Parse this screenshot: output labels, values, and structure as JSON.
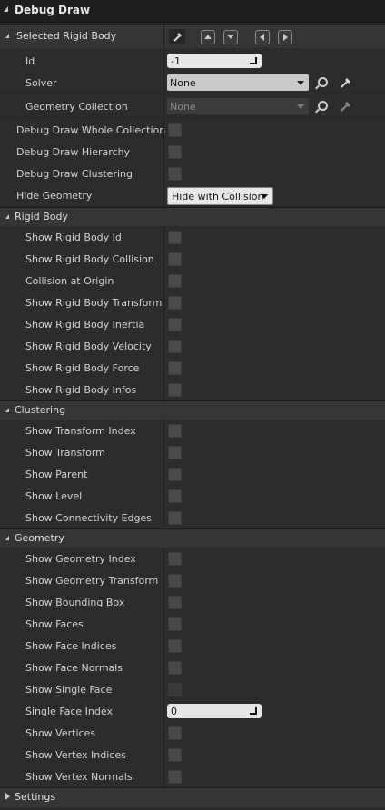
{
  "panel": {
    "title": "Debug Draw",
    "selected_rigid_body": {
      "label": "Selected Rigid Body",
      "pick_icon": "eyedropper-icon",
      "nav_icons": [
        "arrow-up-icon",
        "arrow-down-icon",
        "arrow-left-icon",
        "arrow-right-icon"
      ]
    },
    "id": {
      "label": "Id",
      "value": "-1"
    },
    "solver": {
      "label": "Solver",
      "value": "None"
    },
    "geometry_collection": {
      "label": "Geometry Collection",
      "value": "None"
    },
    "whole_collection": {
      "label": "Debug Draw Whole Collection"
    },
    "hierarchy": {
      "label": "Debug Draw Hierarchy"
    },
    "clustering_top": {
      "label": "Debug Draw Clustering"
    },
    "hide_geometry": {
      "label": "Hide Geometry",
      "value": "Hide with Collision"
    },
    "rigid_body": {
      "title": "Rigid Body",
      "items": [
        "Show Rigid Body Id",
        "Show Rigid Body Collision",
        "Collision at Origin",
        "Show Rigid Body Transform",
        "Show Rigid Body Inertia",
        "Show Rigid Body Velocity",
        "Show Rigid Body Force",
        "Show Rigid Body Infos"
      ]
    },
    "clustering": {
      "title": "Clustering",
      "items": [
        "Show Transform Index",
        "Show Transform",
        "Show Parent",
        "Show Level",
        "Show Connectivity Edges"
      ]
    },
    "geometry": {
      "title": "Geometry",
      "items": [
        "Show Geometry Index",
        "Show Geometry Transform",
        "Show Bounding Box",
        "Show Faces",
        "Show Face Indices",
        "Show Face Normals",
        "Show Single Face"
      ],
      "single_face_index": {
        "label": "Single Face Index",
        "value": "0"
      },
      "items_after": [
        "Show Vertices",
        "Show Vertex Indices",
        "Show Vertex Normals"
      ]
    },
    "settings": {
      "title": "Settings"
    }
  }
}
